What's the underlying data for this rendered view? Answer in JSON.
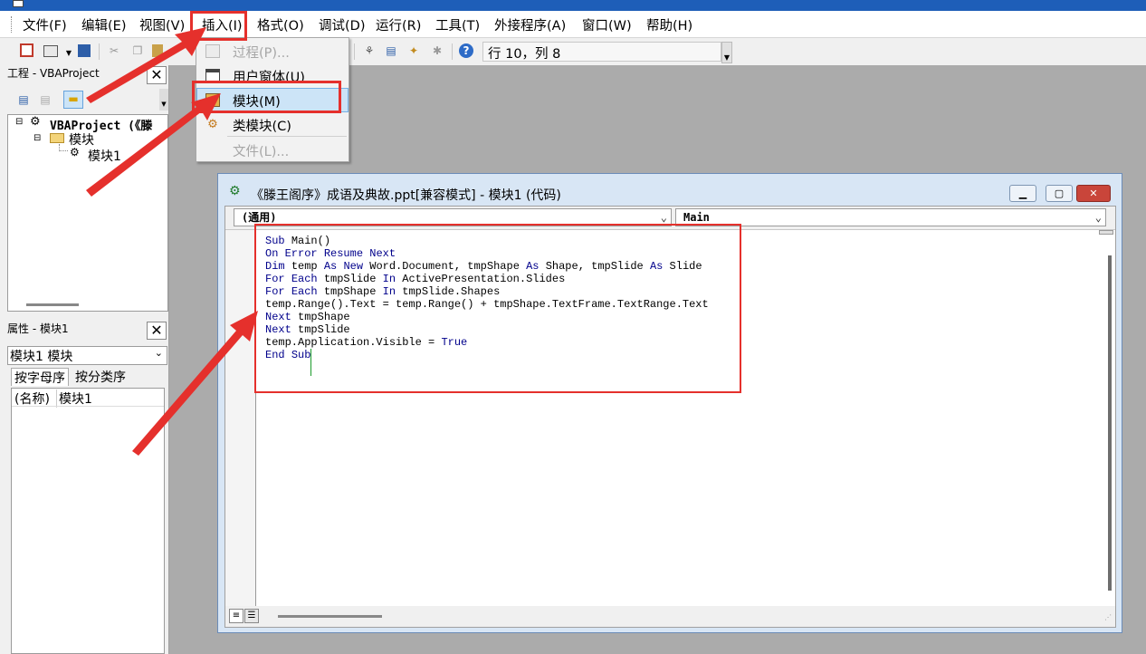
{
  "menubar": {
    "items": [
      "文件(F)",
      "编辑(E)",
      "视图(V)",
      "插入(I)",
      "格式(O)",
      "调试(D)",
      "运行(R)",
      "工具(T)",
      "外接程序(A)",
      "窗口(W)",
      "帮助(H)"
    ]
  },
  "toolbar": {
    "status": "行 10，列 8"
  },
  "insert_menu": {
    "items": [
      {
        "label": "过程(P)...",
        "enabled": false
      },
      {
        "label": "用户窗体(U)",
        "enabled": true
      },
      {
        "label": "模块(M)",
        "enabled": true,
        "highlighted": true
      },
      {
        "label": "类模块(C)",
        "enabled": true
      },
      {
        "label": "文件(L)...",
        "enabled": false
      }
    ]
  },
  "project_panel": {
    "title": "工程 - VBAProject",
    "close": "✕",
    "tree": {
      "root": "VBAProject (《滕",
      "folder": "模块",
      "module": "模块1"
    }
  },
  "properties_panel": {
    "title": "属性 - 模块1",
    "close": "✕",
    "object_select": "模块1 模块",
    "tabs": [
      "按字母序",
      "按分类序"
    ],
    "rows": [
      {
        "name": "(名称)",
        "value": "模块1"
      }
    ]
  },
  "code_window": {
    "title": "《滕王阁序》成语及典故.ppt[兼容模式] - 模块1 (代码)",
    "object_combo": "(通用)",
    "procedure_combo": "Main",
    "code_lines": [
      "Sub Main()",
      "On Error Resume Next",
      "Dim temp As New Word.Document, tmpShape As Shape, tmpSlide As Slide",
      "For Each tmpSlide In ActivePresentation.Slides",
      "For Each tmpShape In tmpSlide.Shapes",
      "temp.Range().Text = temp.Range() + tmpShape.TextFrame.TextRange.Text",
      "Next tmpShape",
      "Next tmpSlide",
      "temp.Application.Visible = True",
      "End Sub"
    ]
  },
  "colors": {
    "annotation_red": "#e5302c",
    "menu_highlight": "#cce4f7",
    "keyword_blue": "#00008b"
  }
}
